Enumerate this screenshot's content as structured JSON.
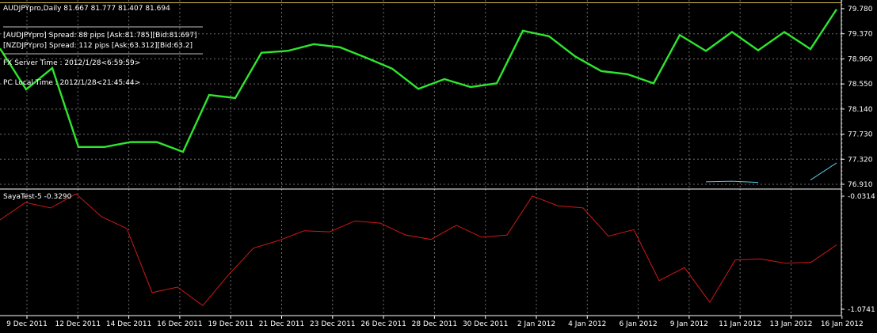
{
  "header": {
    "symbol_line": "AUDJPYpro,Daily  81.667 81.777 81.407 81.694",
    "spread_line_1": "[AUDJPYpro] Spread: 88 pips [Ask:81.785][Bid:81.697]",
    "spread_line_2": "[NZDJPYpro] Spread: 112 pips [Ask:63.312][Bid:63.2]",
    "server_time": "FX Server Time : 2012/1/28<6:59:59>",
    "local_time": "PC Local Time : 2012/1/28<21:45:44>"
  },
  "indicator": {
    "label": "SayaTest-5 -0.3290"
  },
  "colors": {
    "background": "#000000",
    "grid": "#c8c8c8",
    "main_line": "#2ee62e",
    "indicator_line": "#d01818",
    "small_line": "#5fc7e6",
    "text": "#ffffff",
    "separator": "#ffffff"
  },
  "chart_data": [
    {
      "type": "line",
      "title": "AUDJPYpro,Daily",
      "ylim": [
        76.91,
        79.78
      ],
      "y_ticks": [
        "79.780",
        "79.370",
        "78.960",
        "78.550",
        "78.140",
        "77.730",
        "77.320",
        "76.910"
      ],
      "x_tick_labels": [
        "9 Dec 2011",
        "12 Dec 2011",
        "14 Dec 2011",
        "16 Dec 2011",
        "19 Dec 2011",
        "21 Dec 2011",
        "23 Dec 2011",
        "26 Dec 2011",
        "28 Dec 2011",
        "30 Dec 2011",
        "2 Jan 2012",
        "4 Jan 2012",
        "6 Jan 2012",
        "9 Jan 2012",
        "11 Jan 2012",
        "13 Jan 2012",
        "16 Jan 2012"
      ],
      "series": [
        {
          "values": [
            79.13,
            78.46,
            78.81,
            77.52,
            77.52,
            77.6,
            77.6,
            77.44,
            78.37,
            78.32,
            79.06,
            79.09,
            79.2,
            79.15,
            78.98,
            78.8,
            78.47,
            78.63,
            78.5,
            78.56,
            79.42,
            79.33,
            79.0,
            78.76,
            78.71,
            78.56,
            79.35,
            79.09,
            79.4,
            79.1,
            79.4,
            79.12,
            79.77
          ]
        },
        {
          "values": [
            null,
            null,
            null,
            null,
            null,
            null,
            null,
            null,
            null,
            null,
            null,
            null,
            null,
            null,
            null,
            null,
            null,
            null,
            null,
            null,
            null,
            null,
            null,
            null,
            null,
            null,
            null,
            76.95,
            76.96,
            76.94,
            null,
            76.98,
            77.26
          ]
        }
      ]
    },
    {
      "type": "line",
      "title": "SayaTest-5 -0.3290",
      "ylim": [
        -1.0741,
        -0.0314
      ],
      "y_ticks": [
        "-0.0314",
        "-1.0741"
      ],
      "series": [
        {
          "values": [
            -0.25,
            -0.09,
            -0.14,
            -0.01,
            -0.22,
            -0.33,
            -0.92,
            -0.87,
            -1.04,
            -0.76,
            -0.51,
            -0.44,
            -0.35,
            -0.36,
            -0.26,
            -0.28,
            -0.39,
            -0.43,
            -0.3,
            -0.41,
            -0.39,
            -0.03,
            -0.12,
            -0.14,
            -0.4,
            -0.34,
            -0.81,
            -0.69,
            -1.01,
            -0.62,
            -0.61,
            -0.65,
            -0.64,
            -0.48
          ]
        }
      ]
    }
  ]
}
